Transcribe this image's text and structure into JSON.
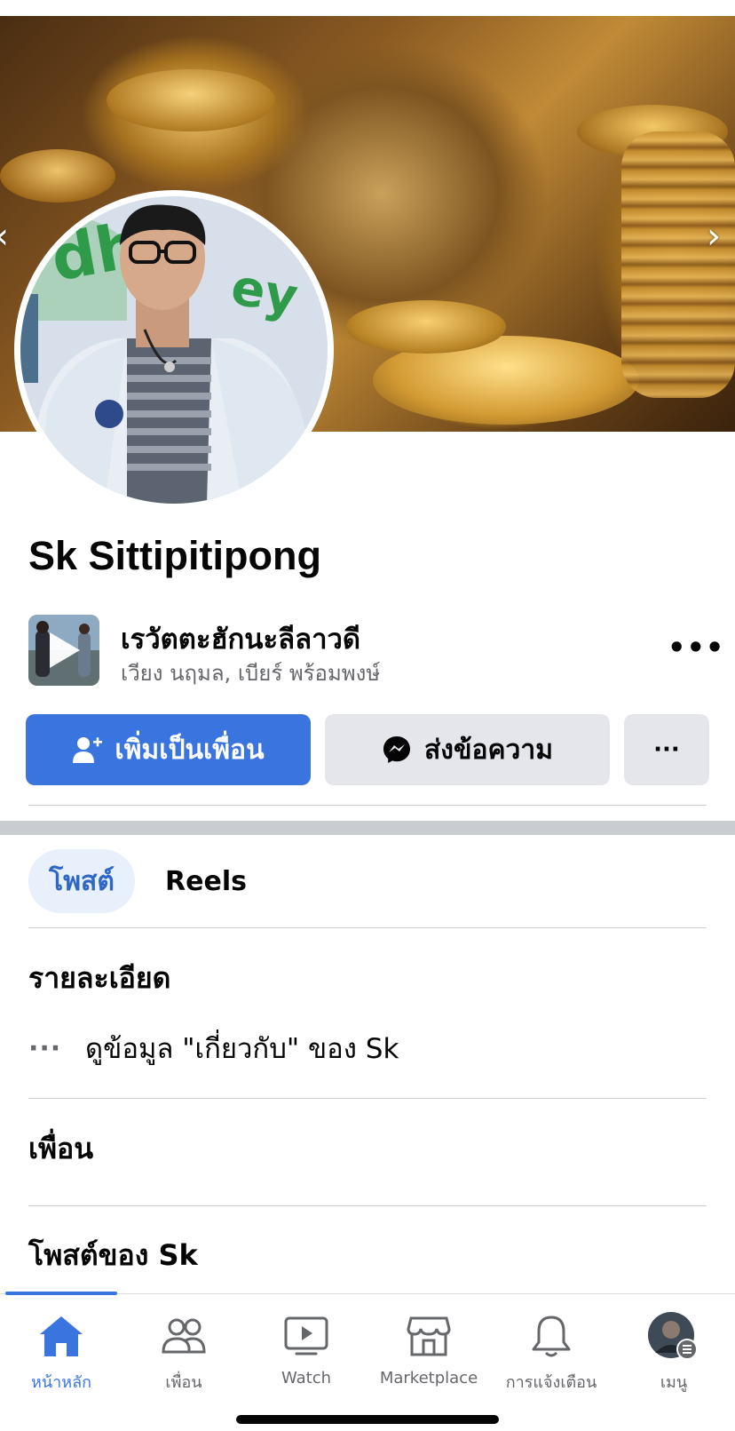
{
  "profile": {
    "name": "Sk Sittipitipong"
  },
  "featured": {
    "title": "เรวัตตะฮักนะลีลาวดี",
    "subtitle": "เวียง นฤมล, เบียร์ พร้อมพงษ์",
    "play_icon": "play-icon",
    "more_icon": "more-horizontal-icon"
  },
  "actions": {
    "add_friend_label": "เพิ่มเป็นเพื่อน",
    "add_friend_icon": "add-friend-icon",
    "message_label": "ส่งข้อความ",
    "message_icon": "messenger-icon",
    "more_label": "···"
  },
  "tabs": [
    {
      "label": "โพสต์",
      "active": true
    },
    {
      "label": "Reels",
      "active": false
    }
  ],
  "details": {
    "heading": "รายละเอียด",
    "about_dots": "···",
    "about_text": "ดูข้อมูล \"เกี่ยวกับ\" ของ Sk"
  },
  "friends": {
    "heading": "เพื่อน"
  },
  "posts": {
    "heading": "โพสต์ของ Sk"
  },
  "navbar": {
    "items": [
      {
        "label": "หน้าหลัก",
        "icon": "home-icon",
        "active": true
      },
      {
        "label": "เพื่อน",
        "icon": "friends-icon",
        "active": false
      },
      {
        "label": "Watch",
        "icon": "watch-icon",
        "active": false
      },
      {
        "label": "Marketplace",
        "icon": "marketplace-icon",
        "active": false
      },
      {
        "label": "การแจ้งเตือน",
        "icon": "bell-icon",
        "active": false
      },
      {
        "label": "เมนู",
        "icon": "menu-avatar-icon",
        "active": false
      }
    ]
  },
  "colors": {
    "accent": "#3a74de",
    "tab_active_bg": "#e7f0fb",
    "secondary_button": "#e4e6eb"
  }
}
